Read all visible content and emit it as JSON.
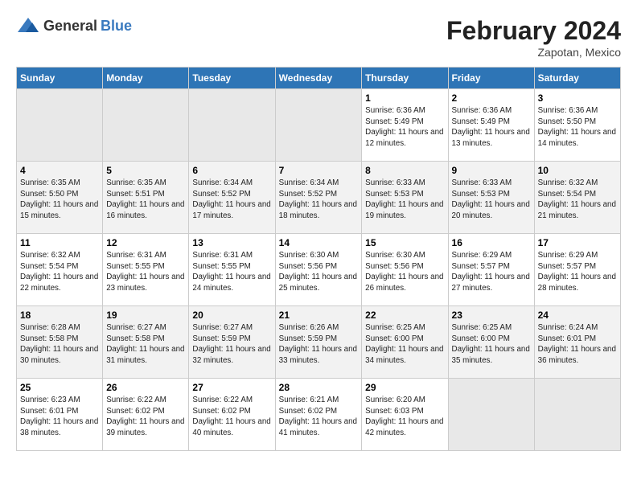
{
  "header": {
    "logo_general": "General",
    "logo_blue": "Blue",
    "title": "February 2024",
    "location": "Zapotan, Mexico"
  },
  "days_of_week": [
    "Sunday",
    "Monday",
    "Tuesday",
    "Wednesday",
    "Thursday",
    "Friday",
    "Saturday"
  ],
  "weeks": [
    [
      {
        "day": "",
        "empty": true
      },
      {
        "day": "",
        "empty": true
      },
      {
        "day": "",
        "empty": true
      },
      {
        "day": "",
        "empty": true
      },
      {
        "day": "1",
        "sunrise": "6:36 AM",
        "sunset": "5:49 PM",
        "daylight": "11 hours and 12 minutes."
      },
      {
        "day": "2",
        "sunrise": "6:36 AM",
        "sunset": "5:49 PM",
        "daylight": "11 hours and 13 minutes."
      },
      {
        "day": "3",
        "sunrise": "6:36 AM",
        "sunset": "5:50 PM",
        "daylight": "11 hours and 14 minutes."
      }
    ],
    [
      {
        "day": "4",
        "sunrise": "6:35 AM",
        "sunset": "5:50 PM",
        "daylight": "11 hours and 15 minutes."
      },
      {
        "day": "5",
        "sunrise": "6:35 AM",
        "sunset": "5:51 PM",
        "daylight": "11 hours and 16 minutes."
      },
      {
        "day": "6",
        "sunrise": "6:34 AM",
        "sunset": "5:52 PM",
        "daylight": "11 hours and 17 minutes."
      },
      {
        "day": "7",
        "sunrise": "6:34 AM",
        "sunset": "5:52 PM",
        "daylight": "11 hours and 18 minutes."
      },
      {
        "day": "8",
        "sunrise": "6:33 AM",
        "sunset": "5:53 PM",
        "daylight": "11 hours and 19 minutes."
      },
      {
        "day": "9",
        "sunrise": "6:33 AM",
        "sunset": "5:53 PM",
        "daylight": "11 hours and 20 minutes."
      },
      {
        "day": "10",
        "sunrise": "6:32 AM",
        "sunset": "5:54 PM",
        "daylight": "11 hours and 21 minutes."
      }
    ],
    [
      {
        "day": "11",
        "sunrise": "6:32 AM",
        "sunset": "5:54 PM",
        "daylight": "11 hours and 22 minutes."
      },
      {
        "day": "12",
        "sunrise": "6:31 AM",
        "sunset": "5:55 PM",
        "daylight": "11 hours and 23 minutes."
      },
      {
        "day": "13",
        "sunrise": "6:31 AM",
        "sunset": "5:55 PM",
        "daylight": "11 hours and 24 minutes."
      },
      {
        "day": "14",
        "sunrise": "6:30 AM",
        "sunset": "5:56 PM",
        "daylight": "11 hours and 25 minutes."
      },
      {
        "day": "15",
        "sunrise": "6:30 AM",
        "sunset": "5:56 PM",
        "daylight": "11 hours and 26 minutes."
      },
      {
        "day": "16",
        "sunrise": "6:29 AM",
        "sunset": "5:57 PM",
        "daylight": "11 hours and 27 minutes."
      },
      {
        "day": "17",
        "sunrise": "6:29 AM",
        "sunset": "5:57 PM",
        "daylight": "11 hours and 28 minutes."
      }
    ],
    [
      {
        "day": "18",
        "sunrise": "6:28 AM",
        "sunset": "5:58 PM",
        "daylight": "11 hours and 30 minutes."
      },
      {
        "day": "19",
        "sunrise": "6:27 AM",
        "sunset": "5:58 PM",
        "daylight": "11 hours and 31 minutes."
      },
      {
        "day": "20",
        "sunrise": "6:27 AM",
        "sunset": "5:59 PM",
        "daylight": "11 hours and 32 minutes."
      },
      {
        "day": "21",
        "sunrise": "6:26 AM",
        "sunset": "5:59 PM",
        "daylight": "11 hours and 33 minutes."
      },
      {
        "day": "22",
        "sunrise": "6:25 AM",
        "sunset": "6:00 PM",
        "daylight": "11 hours and 34 minutes."
      },
      {
        "day": "23",
        "sunrise": "6:25 AM",
        "sunset": "6:00 PM",
        "daylight": "11 hours and 35 minutes."
      },
      {
        "day": "24",
        "sunrise": "6:24 AM",
        "sunset": "6:01 PM",
        "daylight": "11 hours and 36 minutes."
      }
    ],
    [
      {
        "day": "25",
        "sunrise": "6:23 AM",
        "sunset": "6:01 PM",
        "daylight": "11 hours and 38 minutes."
      },
      {
        "day": "26",
        "sunrise": "6:22 AM",
        "sunset": "6:02 PM",
        "daylight": "11 hours and 39 minutes."
      },
      {
        "day": "27",
        "sunrise": "6:22 AM",
        "sunset": "6:02 PM",
        "daylight": "11 hours and 40 minutes."
      },
      {
        "day": "28",
        "sunrise": "6:21 AM",
        "sunset": "6:02 PM",
        "daylight": "11 hours and 41 minutes."
      },
      {
        "day": "29",
        "sunrise": "6:20 AM",
        "sunset": "6:03 PM",
        "daylight": "11 hours and 42 minutes."
      },
      {
        "day": "",
        "empty": true
      },
      {
        "day": "",
        "empty": true
      }
    ]
  ],
  "labels": {
    "sunrise": "Sunrise:",
    "sunset": "Sunset:",
    "daylight": "Daylight:"
  }
}
